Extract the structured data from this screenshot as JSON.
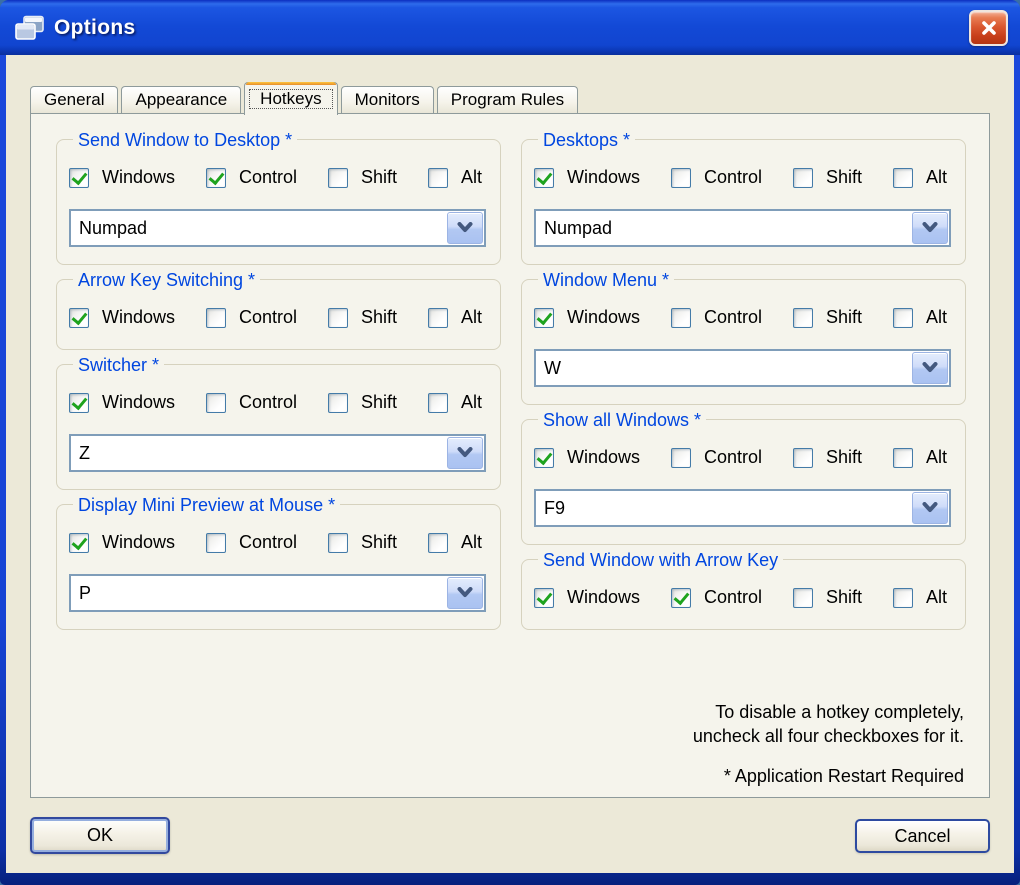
{
  "window": {
    "title": "Options"
  },
  "tabs": [
    {
      "label": "General",
      "active": false
    },
    {
      "label": "Appearance",
      "active": false
    },
    {
      "label": "Hotkeys",
      "active": true
    },
    {
      "label": "Monitors",
      "active": false
    },
    {
      "label": "Program Rules",
      "active": false
    }
  ],
  "modifier_labels": [
    "Windows",
    "Control",
    "Shift",
    "Alt"
  ],
  "groups": [
    {
      "column": "left",
      "title": "Send Window to Desktop *",
      "checks": [
        true,
        true,
        false,
        false
      ],
      "dropdown": "Numpad"
    },
    {
      "column": "left",
      "title": "Arrow Key Switching *",
      "checks": [
        true,
        false,
        false,
        false
      ],
      "dropdown": null
    },
    {
      "column": "left",
      "title": "Switcher *",
      "checks": [
        true,
        false,
        false,
        false
      ],
      "dropdown": "Z"
    },
    {
      "column": "left",
      "title": "Display Mini Preview at Mouse *",
      "checks": [
        true,
        false,
        false,
        false
      ],
      "dropdown": "P"
    },
    {
      "column": "right",
      "title": "Desktops *",
      "checks": [
        true,
        false,
        false,
        false
      ],
      "dropdown": "Numpad"
    },
    {
      "column": "right",
      "title": "Window Menu *",
      "checks": [
        true,
        false,
        false,
        false
      ],
      "dropdown": "W"
    },
    {
      "column": "right",
      "title": "Show all Windows *",
      "checks": [
        true,
        false,
        false,
        false
      ],
      "dropdown": "F9"
    },
    {
      "column": "right",
      "title": "Send Window with Arrow Key",
      "checks": [
        true,
        true,
        false,
        false
      ],
      "dropdown": null
    }
  ],
  "footer": {
    "help_line1": "To disable a hotkey completely,",
    "help_line2": "uncheck all four checkboxes for it.",
    "restart_note": "* Application Restart Required"
  },
  "buttons": {
    "ok": "OK",
    "cancel": "Cancel"
  },
  "colors": {
    "titlebar_blue": "#1349d6",
    "dialog_bg": "#ece9d8",
    "panel_bg": "#f5f4ec",
    "group_title_blue": "#0046e0",
    "check_green": "#1fa31f",
    "active_tab_accent": "#e68b2c",
    "close_button_red": "#d04a22",
    "combo_border": "#7f9db9"
  }
}
